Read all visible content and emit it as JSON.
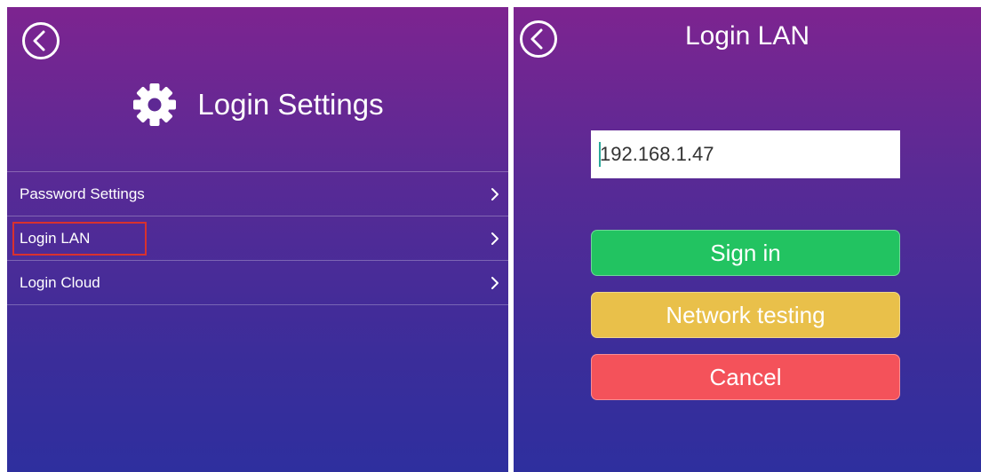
{
  "left_screen": {
    "title": "Login Settings",
    "icons": {
      "back": "back-circle-icon",
      "header": "gear-icon",
      "item_arrow": "chevron-right-icon"
    },
    "menu_items": [
      {
        "label": "Password Settings",
        "highlighted": false
      },
      {
        "label": "Login LAN",
        "highlighted": true
      },
      {
        "label": "Login Cloud",
        "highlighted": false
      }
    ],
    "highlight_color": "#d9312e"
  },
  "right_screen": {
    "title": "Login LAN",
    "icons": {
      "back": "back-circle-icon"
    },
    "ip_input": {
      "value": "192.168.1.47"
    },
    "buttons": {
      "sign_in": "Sign in",
      "network_testing": "Network testing",
      "cancel": "Cancel"
    },
    "colors": {
      "sign_in": "#22c361",
      "network_testing": "#e9c04a",
      "cancel": "#f4525a"
    }
  },
  "theme": {
    "gradient_top": "#7d2490",
    "gradient_bottom": "#2e2f9e"
  }
}
